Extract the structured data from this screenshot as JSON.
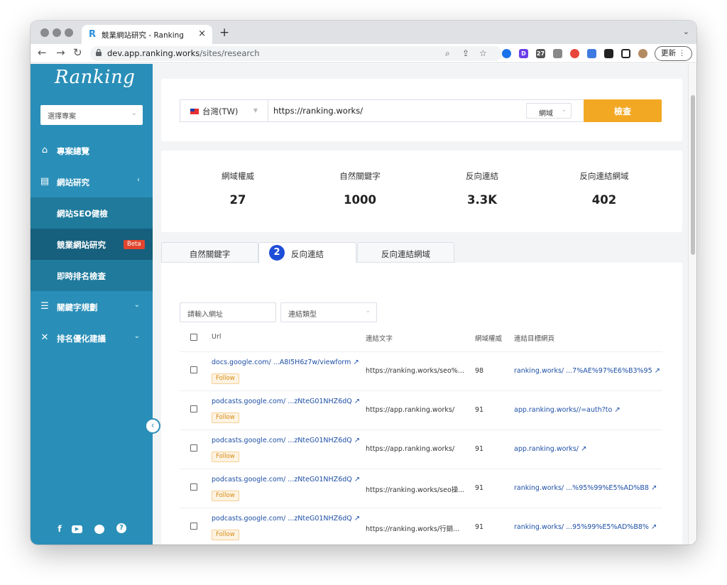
{
  "browser": {
    "tab_title": "競業網站研究 - Ranking",
    "tab_favicon": "R",
    "new_tab": "+",
    "close_tab": "×",
    "url_host": "dev.app.ranking.works",
    "url_path": "/sites/research",
    "update_label": "更新",
    "ext_calendar": "27",
    "ext_d": "D"
  },
  "sidebar": {
    "logo": "Ranking",
    "project_placeholder": "選擇專案",
    "items": [
      {
        "label": "專案總覽",
        "icon": "home-icon"
      },
      {
        "label": "網站研究",
        "icon": "monitor-icon"
      },
      {
        "label": "關鍵字規劃",
        "icon": "list-icon"
      },
      {
        "label": "排名優化建議",
        "icon": "tools-icon"
      }
    ],
    "subitems": [
      {
        "label": "網站SEO健檢"
      },
      {
        "label": "競業網站研究",
        "badge": "Beta"
      },
      {
        "label": "即時排名檢查"
      }
    ],
    "social": [
      "f",
      "▶",
      "line-icon",
      "?"
    ]
  },
  "search": {
    "country": "台灣(TW)",
    "url": "https://ranking.works/",
    "scope": "網域",
    "submit": "檢查"
  },
  "stats": [
    {
      "label": "網域權威",
      "value": "27"
    },
    {
      "label": "自然關鍵字",
      "value": "1000"
    },
    {
      "label": "反向連結",
      "value": "3.3K"
    },
    {
      "label": "反向連結網域",
      "value": "402"
    }
  ],
  "tabs": [
    {
      "label": "自然關鍵字"
    },
    {
      "label": "反向連結",
      "step": "2"
    },
    {
      "label": "反向連結網域"
    }
  ],
  "filters": {
    "url_placeholder": "請輸入網址",
    "type_placeholder": "連結類型"
  },
  "table": {
    "headers": [
      "Url",
      "連結文字",
      "網域權威",
      "連結目標網頁"
    ],
    "rows": [
      {
        "url": "docs.google.com/ ...A8I5H6z7w/viewform",
        "follow": "Follow",
        "anchor": "https://ranking.works/seo%...",
        "dr": "98",
        "target": "ranking.works/ ...7%AE%97%E6%B3%95"
      },
      {
        "url": "podcasts.google.com/ ...zNteG01NHZ6dQ",
        "follow": "Follow",
        "anchor": "https://app.ranking.works/",
        "dr": "91",
        "target": "app.ranking.works//=auth?to"
      },
      {
        "url": "podcasts.google.com/ ...zNteG01NHZ6dQ",
        "follow": "Follow",
        "anchor": "https://app.ranking.works/",
        "dr": "91",
        "target": "app.ranking.works/"
      },
      {
        "url": "podcasts.google.com/ ...zNteG01NHZ6dQ",
        "follow": "Follow",
        "anchor": "https://ranking.works/seo操...",
        "dr": "91",
        "target": "ranking.works/ ...%95%99%E5%AD%B8"
      },
      {
        "url": "podcasts.google.com/ ...zNteG01NHZ6dQ",
        "follow": "Follow",
        "anchor": "https://ranking.works/行銷...",
        "dr": "91",
        "target": "ranking.works/ ...95%99%E5%AD%B8%"
      }
    ]
  },
  "colors": {
    "sidebar": "#2a8fb8",
    "accent": "#f3a823",
    "link": "#1e4fa6",
    "beta": "#e2452e"
  }
}
